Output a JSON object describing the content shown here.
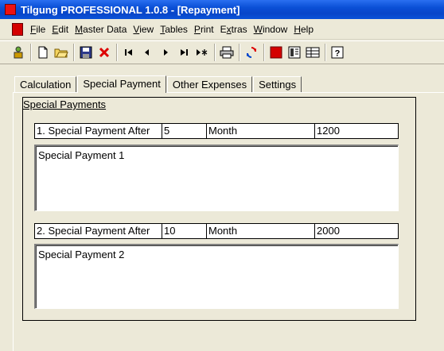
{
  "window": {
    "title": "Tilgung PROFESSIONAL 1.0.8 - [Repayment]"
  },
  "menu": [
    {
      "pre": "",
      "u": "F",
      "post": "ile"
    },
    {
      "pre": "",
      "u": "E",
      "post": "dit"
    },
    {
      "pre": "",
      "u": "M",
      "post": "aster Data"
    },
    {
      "pre": "",
      "u": "V",
      "post": "iew"
    },
    {
      "pre": "",
      "u": "T",
      "post": "ables"
    },
    {
      "pre": "",
      "u": "P",
      "post": "rint"
    },
    {
      "pre": "E",
      "u": "x",
      "post": "tras"
    },
    {
      "pre": "",
      "u": "W",
      "post": "indow"
    },
    {
      "pre": "",
      "u": "H",
      "post": "elp"
    }
  ],
  "tabs": [
    {
      "label": "Calculation",
      "active": false
    },
    {
      "label": "Special Payment",
      "active": true
    },
    {
      "label": "Other Expenses",
      "active": false
    },
    {
      "label": "Settings",
      "active": false
    }
  ],
  "group": {
    "title": "Special Payments"
  },
  "payments": [
    {
      "label": "1. Special Payment After",
      "value": "5",
      "unit": "Month",
      "amount": "1200",
      "memo": "Special Payment 1"
    },
    {
      "label": "2. Special Payment After",
      "value": "10",
      "unit": "Month",
      "amount": "2000",
      "memo": "Special Payment 2"
    }
  ]
}
